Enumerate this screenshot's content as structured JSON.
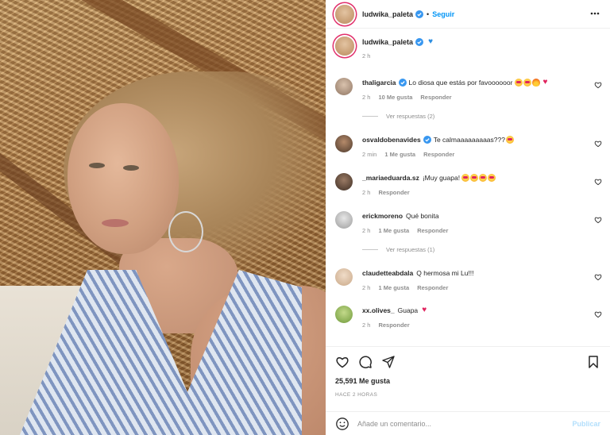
{
  "post": {
    "author": "ludwika_paleta",
    "follow_label": "Seguir",
    "separator": "•",
    "caption_time": "2 h",
    "caption_emoji": "blue-heart",
    "likes": "25,591 Me gusta",
    "timestamp": "HACE 2 HORAS"
  },
  "comments": [
    {
      "user": "thaligarcia",
      "verified": true,
      "text": "Lo diosa que estás por favoooooor",
      "emojis": [
        "heart-eyes",
        "heart-eyes",
        "fire",
        "red-heart"
      ],
      "time": "2 h",
      "likes": "10 Me gusta",
      "reply": "Responder"
    },
    {
      "user": "osvaldobenavides",
      "verified": true,
      "text": "Te calmaaaaaaaaas???",
      "emojis": [
        "heart-eyes"
      ],
      "time": "2 min",
      "likes": "1 Me gusta",
      "reply": "Responder"
    },
    {
      "user": "_mariaeduarda.sz",
      "verified": false,
      "text": "¡Muy guapa!",
      "emojis": [
        "heart-eyes",
        "heart-eyes",
        "heart-eyes",
        "heart-eyes"
      ],
      "time": "2 h",
      "likes": "",
      "reply": "Responder"
    },
    {
      "user": "erickmoreno",
      "verified": false,
      "text": "Qué bonita",
      "emojis": [],
      "time": "2 h",
      "likes": "1 Me gusta",
      "reply": "Responder"
    },
    {
      "user": "claudetteabdala",
      "verified": false,
      "text": "Q hermosa mi Lu!!!",
      "emojis": [],
      "time": "2 h",
      "likes": "1 Me gusta",
      "reply": "Responder"
    },
    {
      "user": "xx.olives_",
      "verified": false,
      "text": "Guapa",
      "emojis": [
        "red-heart"
      ],
      "time": "2 h",
      "likes": "",
      "reply": "Responder"
    }
  ],
  "view_replies": [
    {
      "label": "Ver respuestas (2)"
    },
    {
      "label": "Ver respuestas (1)"
    }
  ],
  "compose": {
    "placeholder": "Añade un comentario...",
    "publish_label": "Publicar"
  },
  "icons": {
    "more": "more-horizontal-icon",
    "like": "heart-outline-icon",
    "comment": "comment-bubble-icon",
    "share": "paper-plane-icon",
    "save": "bookmark-icon",
    "emoji": "smiley-icon"
  },
  "colors": {
    "accent": "#0095f6",
    "verified": "#3897f0",
    "muted": "#8e8e8e",
    "publish_disabled": "#b2dffc"
  }
}
